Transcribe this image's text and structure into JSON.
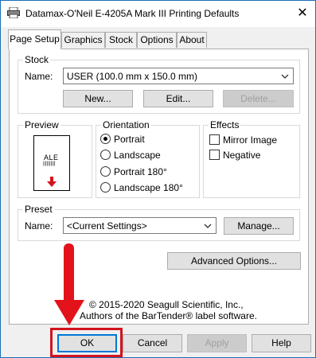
{
  "window": {
    "title": "Datamax-O'Neil E-4205A Mark III Printing Defaults",
    "close_glyph": "✕"
  },
  "tabs": [
    {
      "label": "Page Setup",
      "active": true
    },
    {
      "label": "Graphics",
      "active": false
    },
    {
      "label": "Stock",
      "active": false
    },
    {
      "label": "Options",
      "active": false
    },
    {
      "label": "About",
      "active": false
    }
  ],
  "stock": {
    "legend": "Stock",
    "name_label": "Name:",
    "name_value": "USER (100.0 mm x 150.0 mm)",
    "new_button": "New...",
    "edit_button": "Edit...",
    "delete_button": "Delete..."
  },
  "preview": {
    "legend": "Preview",
    "label_text": "ALE",
    "barcode_text": "||||||||||"
  },
  "orientation": {
    "legend": "Orientation",
    "options": [
      {
        "label": "Portrait",
        "checked": true
      },
      {
        "label": "Landscape",
        "checked": false
      },
      {
        "label": "Portrait 180°",
        "checked": false
      },
      {
        "label": "Landscape 180°",
        "checked": false
      }
    ]
  },
  "effects": {
    "legend": "Effects",
    "options": [
      {
        "label": "Mirror Image",
        "checked": false
      },
      {
        "label": "Negative",
        "checked": false
      }
    ]
  },
  "preset": {
    "legend": "Preset",
    "name_label": "Name:",
    "name_value": "<Current Settings>",
    "manage_button": "Manage..."
  },
  "advanced_button": "Advanced Options...",
  "copyright": {
    "line1": "© 2015-2020 Seagull Scientific, Inc.,",
    "line2": "Authors of the BarTender® label software."
  },
  "footer": {
    "ok": "OK",
    "cancel": "Cancel",
    "apply": "Apply",
    "help": "Help"
  },
  "colors": {
    "annotation_red": "#e3131b",
    "focus_blue": "#0078d7",
    "title_border": "#1b6fb8"
  },
  "icons": {
    "window_icon": "printer-icon",
    "close": "close-icon",
    "dropdown": "chevron-down-icon",
    "annotation": "red-arrow-pointer"
  }
}
